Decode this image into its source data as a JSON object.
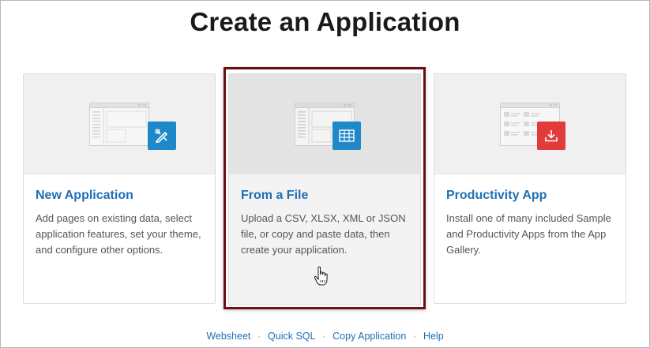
{
  "page": {
    "title": "Create an Application"
  },
  "cards": [
    {
      "title": "New Application",
      "description": "Add pages on existing data, select application features, set your theme, and configure other options.",
      "icon": "edit-tools-icon",
      "icon_color": "#1e88c8"
    },
    {
      "title": "From a File",
      "description": "Upload a CSV, XLSX, XML or JSON file, or copy and paste data, then create your application.",
      "icon": "table-grid-icon",
      "icon_color": "#1e88c8"
    },
    {
      "title": "Productivity App",
      "description": "Install one of many included Sample and Productivity Apps from the App Gallery.",
      "icon": "download-icon",
      "icon_color": "#e23b3b"
    }
  ],
  "footer": {
    "links": [
      "Websheet",
      "Quick SQL",
      "Copy Application",
      "Help"
    ],
    "separator": "·"
  },
  "colors": {
    "link": "#1f6fb5",
    "selection": "#6b0f12"
  }
}
